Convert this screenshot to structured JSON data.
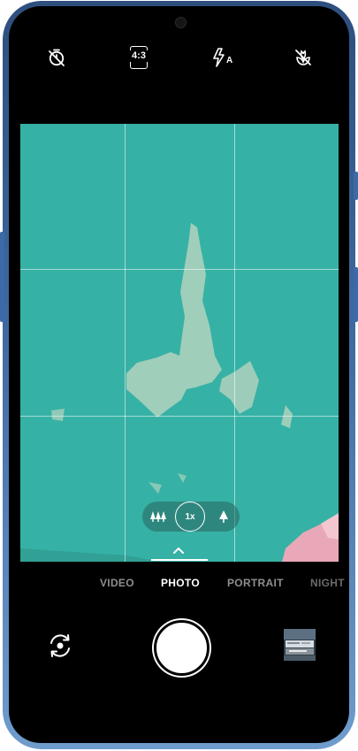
{
  "device": {
    "frame_color": "#3f6aa1",
    "screen_color": "#000000"
  },
  "top_controls": [
    {
      "name": "timer-off-icon",
      "label": ""
    },
    {
      "name": "aspect-ratio",
      "label": "4:3"
    },
    {
      "name": "flash-auto-icon",
      "label": "A"
    },
    {
      "name": "macro-off-icon",
      "label": ""
    }
  ],
  "viewfinder": {
    "background_color": "#39b5a9",
    "grid": "3x3"
  },
  "lens_selector": {
    "wide_icon": "trees-icon",
    "zoom_label": "1x",
    "tele_icon": "tree-icon"
  },
  "modes": [
    {
      "label": "VIDEO",
      "active": false
    },
    {
      "label": "PHOTO",
      "active": true
    },
    {
      "label": "PORTRAIT",
      "active": false
    },
    {
      "label": "NIGHT",
      "active": false
    }
  ],
  "bottom_controls": {
    "flip_icon": "camera-flip-icon",
    "shutter_icon": "shutter-button",
    "gallery_icon": "gallery-thumbnail"
  }
}
